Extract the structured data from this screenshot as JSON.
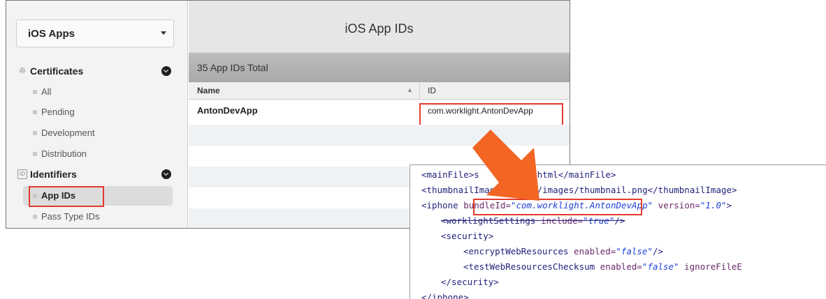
{
  "portal": {
    "platform_select": "iOS Apps",
    "sidebar": {
      "certificates": {
        "title": "Certificates",
        "items": [
          "All",
          "Pending",
          "Development",
          "Distribution"
        ]
      },
      "identifiers": {
        "title": "Identifiers",
        "items": [
          "App IDs",
          "Pass Type IDs"
        ]
      }
    },
    "main": {
      "title": "iOS App IDs",
      "count_label": "35 App IDs Total",
      "columns": {
        "name": "Name",
        "id": "ID"
      },
      "rows": [
        {
          "name": "AntonDevApp",
          "id": "com.worklight.AntonDevApp"
        }
      ]
    }
  },
  "code": {
    "line1_open": "<mainFile>",
    "line1_text": "s",
    "line1_text2": "s.html",
    "line1_close": "</mainFile>",
    "line2_open": "<thumbnailImage>",
    "line2_text": "common/images/thumbnail.png",
    "line2_close": "</thumbnailImage>",
    "line3_tag": "<iphone",
    "line3_attr": "bundleId=",
    "line3_val": "\"com.worklight.AntonDevApp\"",
    "line3_attr2": "version=",
    "line3_val2": "\"1.0\"",
    "line3_end": ">",
    "line4_tag": "<worklightSettings",
    "line4_attr": "include=",
    "line4_val": "\"true\"",
    "line4_end": "/>",
    "line5": "<security>",
    "line6_tag": "<encryptWebResources",
    "line6_attr": "enabled=",
    "line6_val": "\"false\"",
    "line6_end": "/>",
    "line7_tag": "<testWebResourcesChecksum",
    "line7_attr": "enabled=",
    "line7_val": "\"false\"",
    "line7_attr2": "ignoreFileE",
    "line8": "</security>",
    "line9": "</iphone>"
  },
  "colors": {
    "highlight": "#e23a2c",
    "arrow": "#f26522",
    "xml_value": "#1e3fd6"
  }
}
